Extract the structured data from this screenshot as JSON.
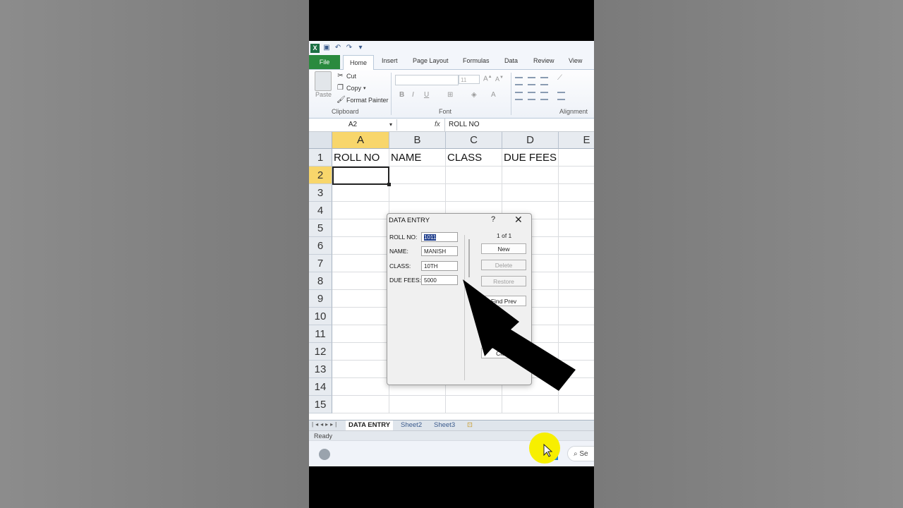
{
  "quick_access": {
    "excel_icon": "X",
    "undo_icon": "undo-icon",
    "redo_icon": "redo-icon",
    "save_icon": "save-icon"
  },
  "ribbon_tabs": [
    "File",
    "Home",
    "Insert",
    "Page Layout",
    "Formulas",
    "Data",
    "Review",
    "View"
  ],
  "ribbon": {
    "paste_label": "Paste",
    "cut_label": "Cut",
    "copy_label": "Copy",
    "format_painter_label": "Format Painter",
    "font_size": "11",
    "group_clipboard": "Clipboard",
    "group_font": "Font",
    "group_alignment": "Alignment"
  },
  "formula_bar": {
    "name_box": "A2",
    "fx": "fx",
    "content": "ROLL NO"
  },
  "grid": {
    "columns": [
      "A",
      "B",
      "C",
      "D",
      "E"
    ],
    "rows": [
      "1",
      "2",
      "3",
      "4",
      "5",
      "6",
      "7",
      "8",
      "9",
      "10",
      "11",
      "12",
      "13",
      "14",
      "15"
    ],
    "row1": [
      "ROLL NO",
      "NAME",
      "CLASS",
      "DUE FEES"
    ]
  },
  "dialog": {
    "title": "DATA ENTRY",
    "help": "?",
    "close": "✕",
    "record_counter": "1 of 1",
    "fields": [
      {
        "label": "ROLL NO:",
        "value": "1011"
      },
      {
        "label": "NAME:",
        "value": "MANISH"
      },
      {
        "label": "CLASS:",
        "value": "10TH"
      },
      {
        "label": "DUE FEES:",
        "value": "5000"
      }
    ],
    "buttons": {
      "new": "New",
      "delete": "Delete",
      "restore": "Restore",
      "find_prev": "Find Prev",
      "close": "Close"
    }
  },
  "sheet_tabs": [
    "DATA ENTRY",
    "Sheet2",
    "Sheet3"
  ],
  "status": "Ready",
  "taskbar": {
    "search": "Se"
  },
  "colors": {
    "file_tab": "#2a8a3e",
    "selected_header": "#f8d66b",
    "windows_blue": "#1a86d9",
    "cursor_highlight": "#f7ef00"
  }
}
